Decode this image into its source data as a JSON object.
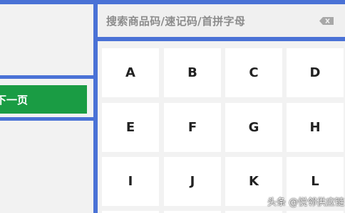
{
  "left": {
    "next_page_label": "下一页"
  },
  "search": {
    "placeholder": "搜索商品码/速记码/首拼字母"
  },
  "keys": [
    "A",
    "B",
    "C",
    "D",
    "E",
    "F",
    "G",
    "H",
    "I",
    "J",
    "K",
    "L"
  ],
  "watermark": "头条 @悦邻供应链",
  "colors": {
    "accent": "#4a72d6",
    "button_green": "#1a9c44",
    "key_bg": "#ffffff",
    "panel_bg": "#f2f2f2"
  }
}
